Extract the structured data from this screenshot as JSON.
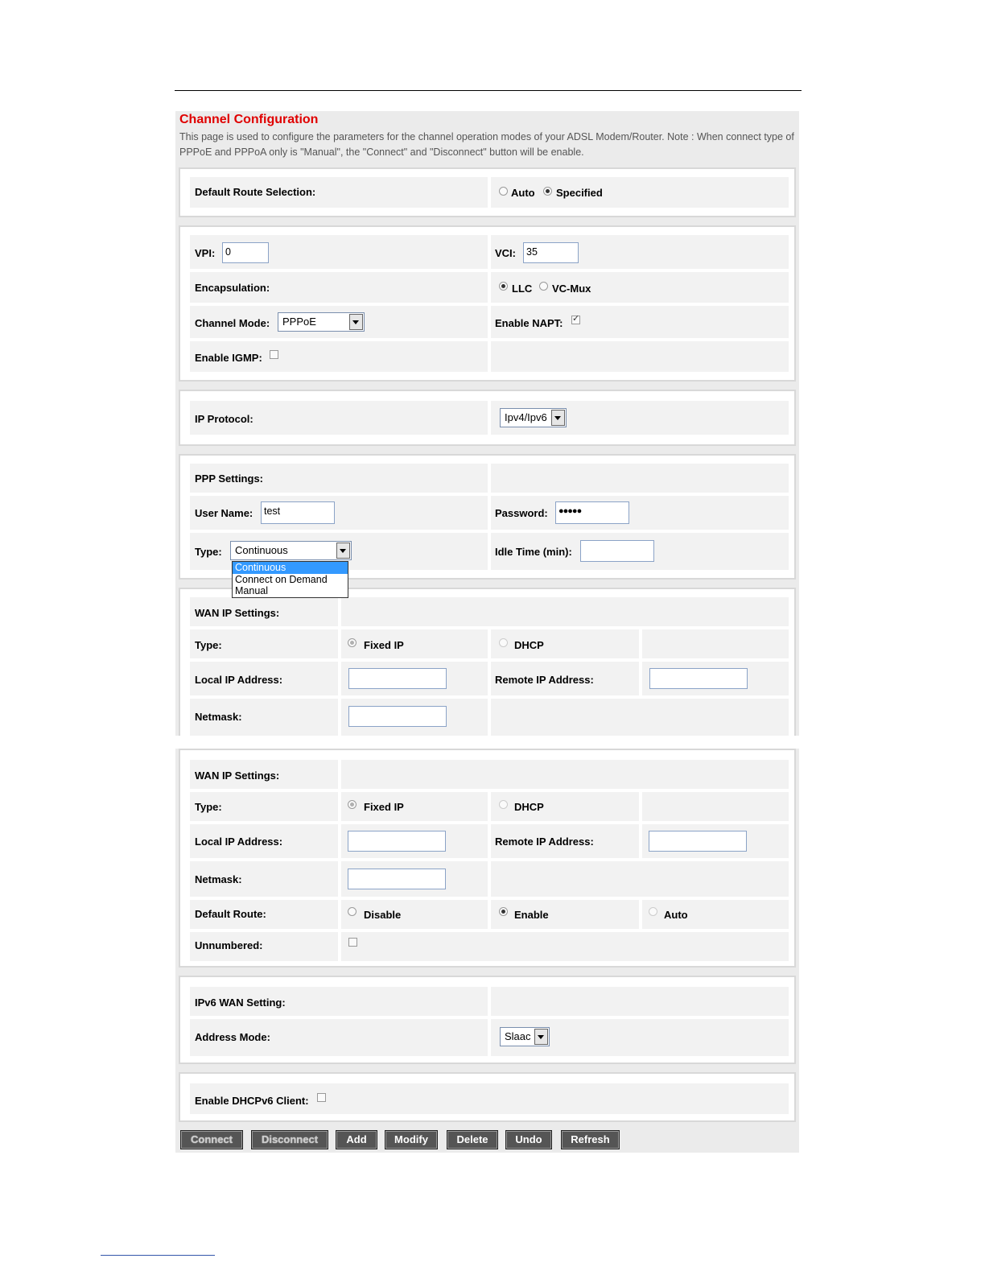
{
  "header": {
    "title": "Channel Configuration",
    "description": "This page is used to configure the parameters for the channel operation modes of your ADSL Modem/Router. Note : When connect type of PPPoE and PPPoA only is \"Manual\", the \"Connect\" and \"Disconnect\" button will be enable."
  },
  "default_route_selection": {
    "label": "Default Route Selection:",
    "options": [
      "Auto",
      "Specified"
    ],
    "selected": "Specified"
  },
  "channel": {
    "vpi_label": "VPI:",
    "vpi_value": "0",
    "vci_label": "VCI:",
    "vci_value": "35",
    "encapsulation_label": "Encapsulation:",
    "encapsulation_options": [
      "LLC",
      "VC-Mux"
    ],
    "encapsulation_selected": "LLC",
    "channel_mode_label": "Channel Mode:",
    "channel_mode_value": "PPPoE",
    "enable_napt_label": "Enable NAPT:",
    "enable_napt_checked": true,
    "enable_igmp_label": "Enable IGMP:",
    "enable_igmp_checked": false
  },
  "ip_protocol": {
    "label": "IP Protocol:",
    "value": "Ipv4/Ipv6"
  },
  "ppp": {
    "section_label": "PPP Settings:",
    "username_label": "User Name:",
    "username_value": "test",
    "password_label": "Password:",
    "password_value": "●●●●●",
    "type_label": "Type:",
    "type_value": "Continuous",
    "type_options": [
      "Continuous",
      "Connect on Demand",
      "Manual"
    ],
    "idle_label": "Idle Time (min):",
    "idle_value": ""
  },
  "wan_ip": {
    "section_label": "WAN IP Settings:",
    "type_label": "Type:",
    "type_options": [
      "Fixed IP",
      "DHCP"
    ],
    "local_ip_label": "Local IP Address:",
    "remote_ip_label": "Remote IP Address:",
    "netmask_label": "Netmask:",
    "default_route_label": "Default Route:",
    "default_route_options": [
      "Disable",
      "Enable",
      "Auto"
    ],
    "default_route_selected": "Enable",
    "unnumbered_label": "Unnumbered:"
  },
  "ipv6": {
    "section_label": "IPv6 WAN Setting:",
    "address_mode_label": "Address Mode:",
    "address_mode_value": "Slaac",
    "dhcpv6_label": "Enable DHCPv6 Client:"
  },
  "buttons": {
    "connect": "Connect",
    "disconnect": "Disconnect",
    "add": "Add",
    "modify": "Modify",
    "delete": "Delete",
    "undo": "Undo",
    "refresh": "Refresh"
  }
}
